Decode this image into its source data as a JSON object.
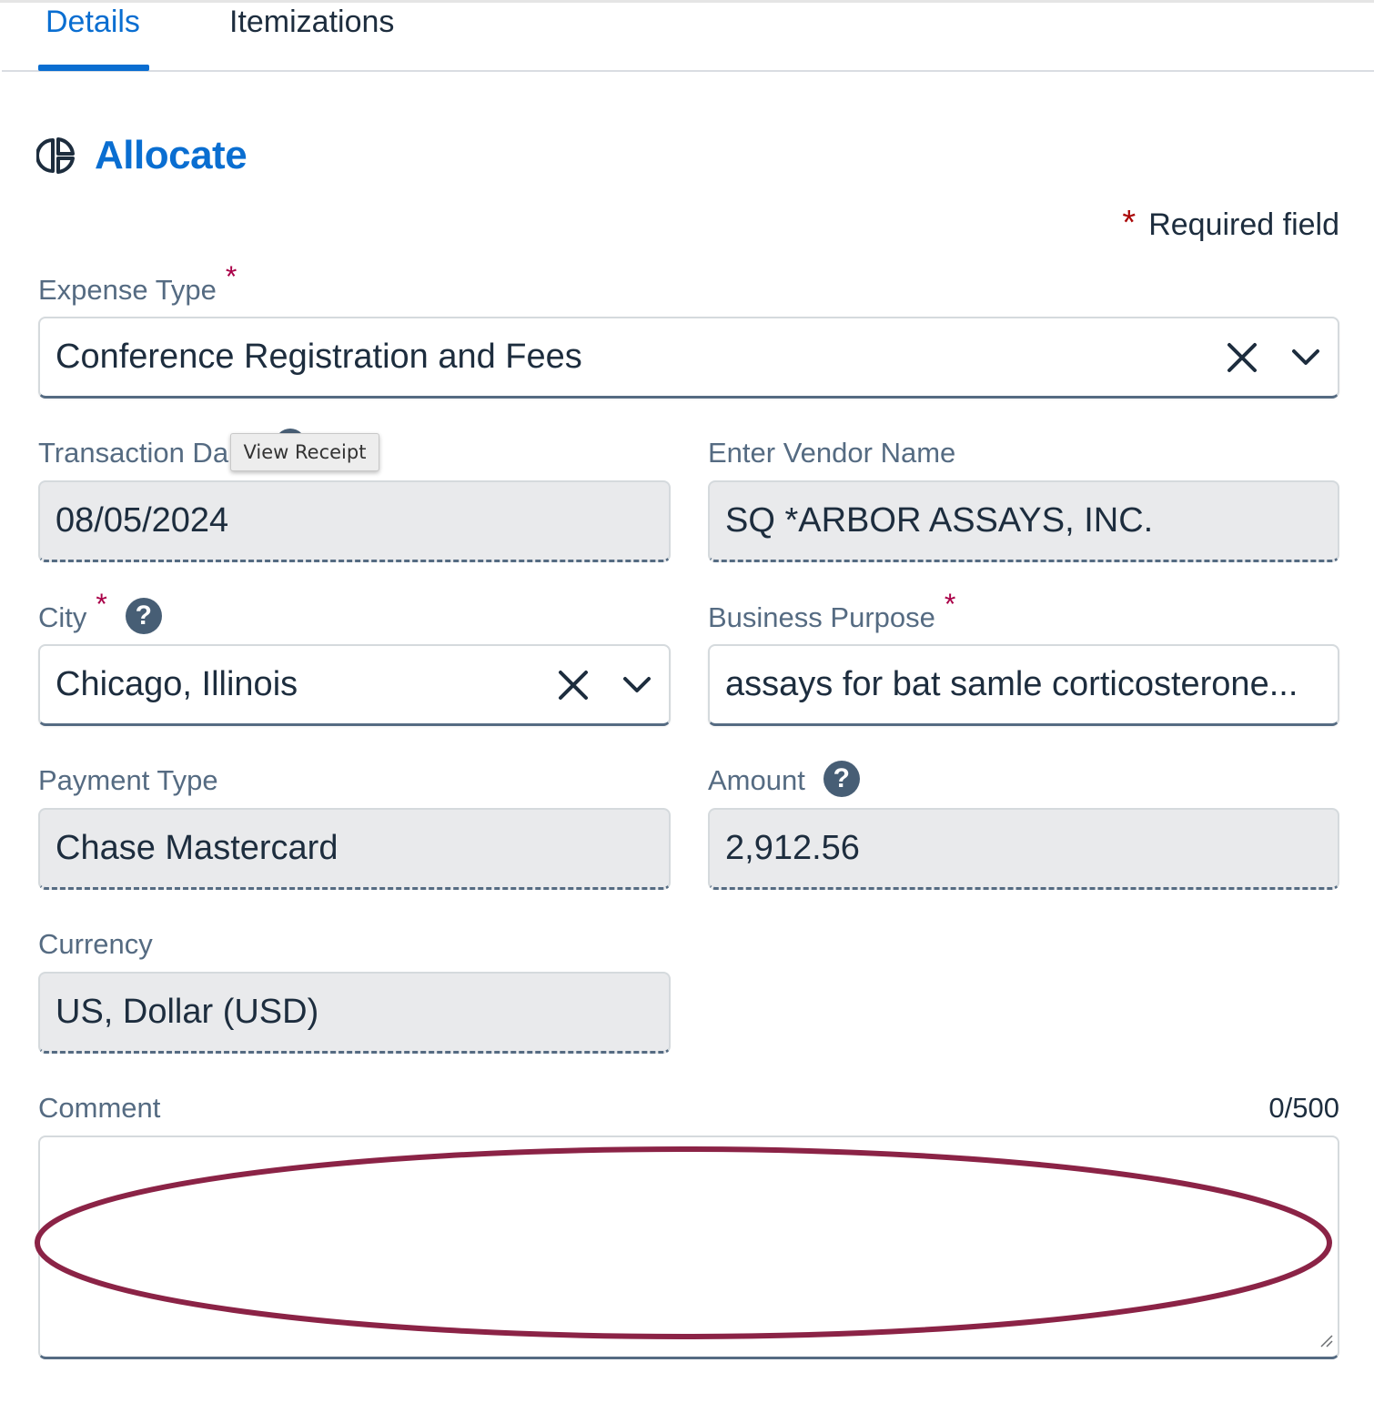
{
  "tabs": [
    {
      "label": "Details",
      "active": true
    },
    {
      "label": "Itemizations",
      "active": false
    }
  ],
  "allocate": {
    "label": "Allocate",
    "icon": "pie-chart-icon"
  },
  "required_note": {
    "star": "*",
    "text": "Required field"
  },
  "fields": {
    "expense_type": {
      "label": "Expense Type",
      "required": "*",
      "value": "Conference Registration and Fees"
    },
    "transaction_date": {
      "label": "Transaction Da",
      "value": "08/05/2024"
    },
    "vendor_name": {
      "label": "Enter Vendor Name",
      "value": "SQ *ARBOR ASSAYS, INC."
    },
    "city": {
      "label": "City",
      "required": "*",
      "help": "?",
      "value": "Chicago, Illinois"
    },
    "business_purpose": {
      "label": "Business Purpose",
      "required": "*",
      "value": "assays for bat samle corticosterone..."
    },
    "payment_type": {
      "label": "Payment Type",
      "value": "Chase Mastercard"
    },
    "amount": {
      "label": "Amount",
      "help": "?",
      "value": "2,912.56"
    },
    "currency": {
      "label": "Currency",
      "value": "US, Dollar (USD)"
    },
    "comment": {
      "label": "Comment",
      "counter": "0/500",
      "value": ""
    }
  },
  "tooltip": {
    "text": "View Receipt"
  },
  "colors": {
    "accent": "#0a6ed1",
    "required": "#aa0048",
    "annotation": "#8b2346"
  }
}
